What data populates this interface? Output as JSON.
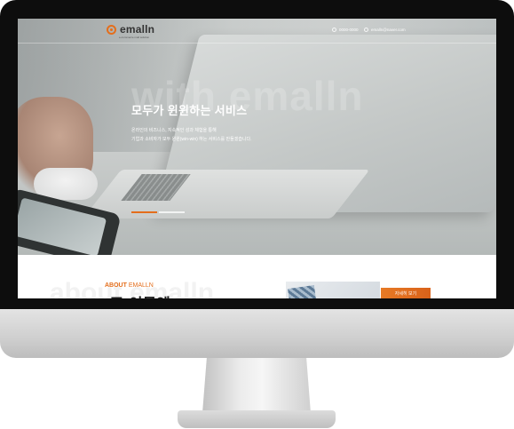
{
  "header": {
    "logo_text": "emalln",
    "logo_sub": "e-commerce mall solution",
    "phone": "0000-0000",
    "email": "emalln@naver.com"
  },
  "hero": {
    "background_word": "with emalln",
    "headline": "모두가 윈윈하는 서비스",
    "desc_line1": "온라인의 비즈니스, 지속적인 성과 체험을 통해",
    "desc_line2": "기업과 소비자가 모두 윈윈(win-win) 하는 서비스를 만들겠습니다.",
    "slides_total": 2,
    "active_slide": 1
  },
  "about": {
    "label_prefix": "ABOUT",
    "label_brand": "EMALLN",
    "background_word": "about emalln",
    "title": "(주)이몰엔",
    "button": "자세히 보기"
  },
  "colors": {
    "accent": "#e46e1c",
    "bezel": "#0d0d0d"
  }
}
